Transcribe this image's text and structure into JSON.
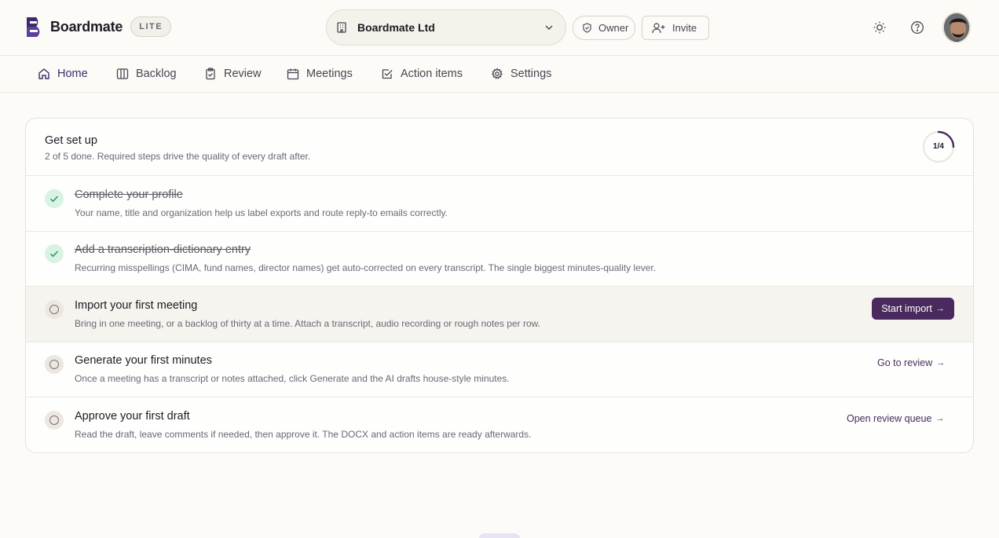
{
  "header": {
    "brand_name": "Boardmate",
    "plan_badge": "LITE",
    "org_name": "Boardmate Ltd",
    "role_label": "Owner",
    "invite_label": "Invite"
  },
  "nav": {
    "items": [
      {
        "label": "Home",
        "icon": "home-icon",
        "active": true
      },
      {
        "label": "Backlog",
        "icon": "columns-icon",
        "active": false
      },
      {
        "label": "Review",
        "icon": "clipboard-check-icon",
        "active": false
      },
      {
        "label": "Meetings",
        "icon": "calendar-icon",
        "active": false
      },
      {
        "label": "Action items",
        "icon": "checkbox-icon",
        "active": false
      },
      {
        "label": "Settings",
        "icon": "gear-icon",
        "active": false
      }
    ]
  },
  "setup": {
    "title": "Get set up",
    "subtitle": "2 of 5 done. Required steps drive the quality of every draft after.",
    "progress_label": "1/4",
    "progress_fraction": 0.25,
    "steps": [
      {
        "title": "Complete your profile",
        "description": "Your name, title and organization help us label exports and route reply-to emails correctly.",
        "done": true,
        "action": ""
      },
      {
        "title": "Add a transcription-dictionary entry",
        "description": "Recurring misspellings (CIMA, fund names, director names) get auto-corrected on every transcript. The single biggest minutes-quality lever.",
        "done": true,
        "action": ""
      },
      {
        "title": "Import your first meeting",
        "description": "Bring in one meeting, or a backlog of thirty at a time. Attach a transcript, audio recording or rough notes per row.",
        "done": false,
        "action": "Start import"
      },
      {
        "title": "Generate your first minutes",
        "description": "Once a meeting has a transcript or notes attached, click Generate and the AI drafts house-style minutes.",
        "done": false,
        "action": "Go to review"
      },
      {
        "title": "Approve your first draft",
        "description": "Read the draft, leave comments if needed, then approve it. The DOCX and action items are ready afterwards.",
        "done": false,
        "action": "Open review queue"
      }
    ]
  },
  "colors": {
    "accent": "#4a2a5e",
    "done_bg": "#d9f2e3",
    "done_check": "#2f9e5f",
    "page_bg": "#fcfbf7"
  }
}
